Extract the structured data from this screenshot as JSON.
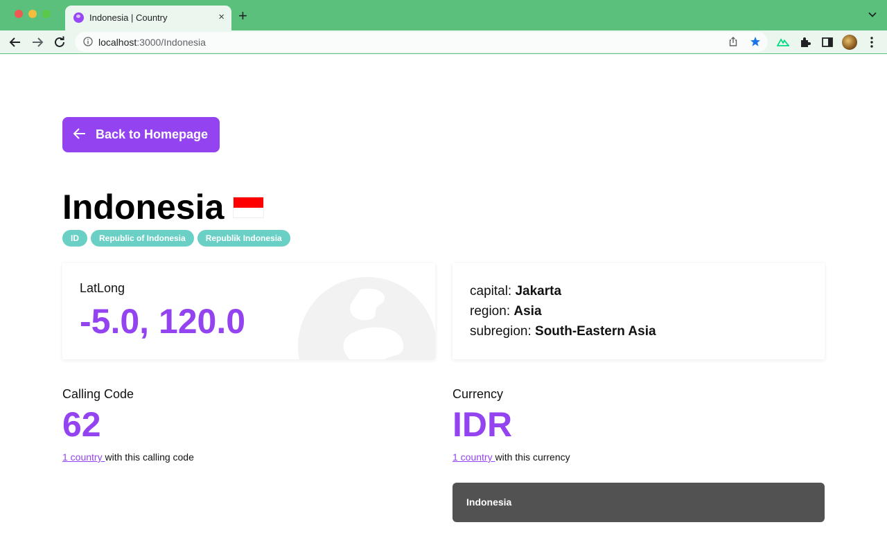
{
  "browser": {
    "tab_title": "Indonesia | Country",
    "tab_close": "×",
    "new_tab": "+",
    "url_host": "localhost",
    "url_path": ":3000/Indonesia"
  },
  "page": {
    "back_button": "Back to Homepage",
    "country_name": "Indonesia",
    "flag_colors": [
      "#ff0000",
      "#ffffff"
    ],
    "badges": [
      "ID",
      "Republic of Indonesia",
      "Republik Indonesia"
    ],
    "latlong": {
      "label": "LatLong",
      "value": "-5.0, 120.0"
    },
    "info": {
      "capital_label": "capital:",
      "capital": "Jakarta",
      "region_label": "region:",
      "region": "Asia",
      "subregion_label": "subregion:",
      "subregion": "South-Eastern Asia"
    },
    "calling_code": {
      "label": "Calling Code",
      "value": "62",
      "link": "1 country ",
      "suffix": "with this calling code"
    },
    "currency": {
      "label": "Currency",
      "value": "IDR",
      "link": "1 country ",
      "suffix": "with this currency"
    },
    "currency_countries": [
      "Indonesia"
    ]
  },
  "colors": {
    "accent": "#9344f0",
    "badge": "#6ad0c5",
    "chrome": "#5bc07c",
    "list_item": "#525252"
  }
}
